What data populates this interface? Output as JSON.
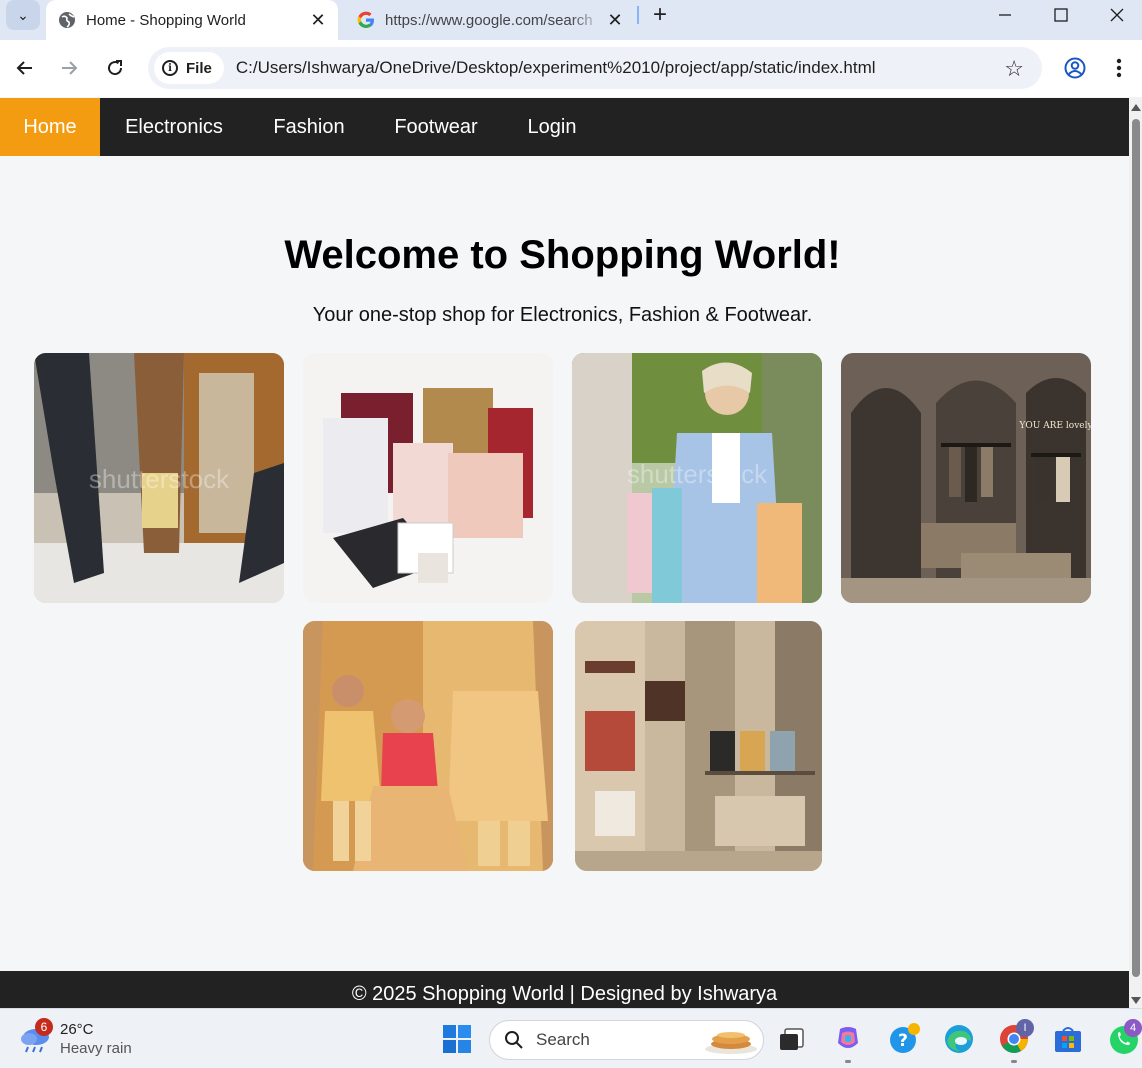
{
  "browser": {
    "tabs": [
      {
        "title": "Home - Shopping World",
        "active": true
      },
      {
        "title": "https://www.google.com/search",
        "active": false
      }
    ],
    "site_chip": "File",
    "url": "C:/Users/Ishwarya/OneDrive/Desktop/experiment%2010/project/app/static/index.html"
  },
  "page": {
    "nav": {
      "items": [
        "Home",
        "Electronics",
        "Fashion",
        "Footwear",
        "Login"
      ],
      "active_color": "#f39c12",
      "bar_color": "#222222"
    },
    "hero": {
      "title": "Welcome to Shopping World!",
      "subtitle": "Your one-stop shop for Electronics, Fashion & Footwear."
    },
    "gallery": [
      {
        "name": "shoppers-walking-with-bags",
        "watermark": "shutterstock"
      },
      {
        "name": "gift-shopping-bags"
      },
      {
        "name": "woman-holding-shopping-bags",
        "watermark": "shutterstock"
      },
      {
        "name": "boutique-clothing-store-interior",
        "sign_text": "YOU ARE lovely"
      },
      {
        "name": "family-ethnic-wear"
      },
      {
        "name": "handbag-store-shelves"
      }
    ],
    "footer": "© 2025 Shopping World | Designed by Ishwarya"
  },
  "taskbar": {
    "weather": {
      "badge": "6",
      "temp": "26°C",
      "desc": "Heavy rain"
    },
    "search_placeholder": "Search",
    "teams_badge": "I",
    "whatsapp_badge": "4"
  }
}
